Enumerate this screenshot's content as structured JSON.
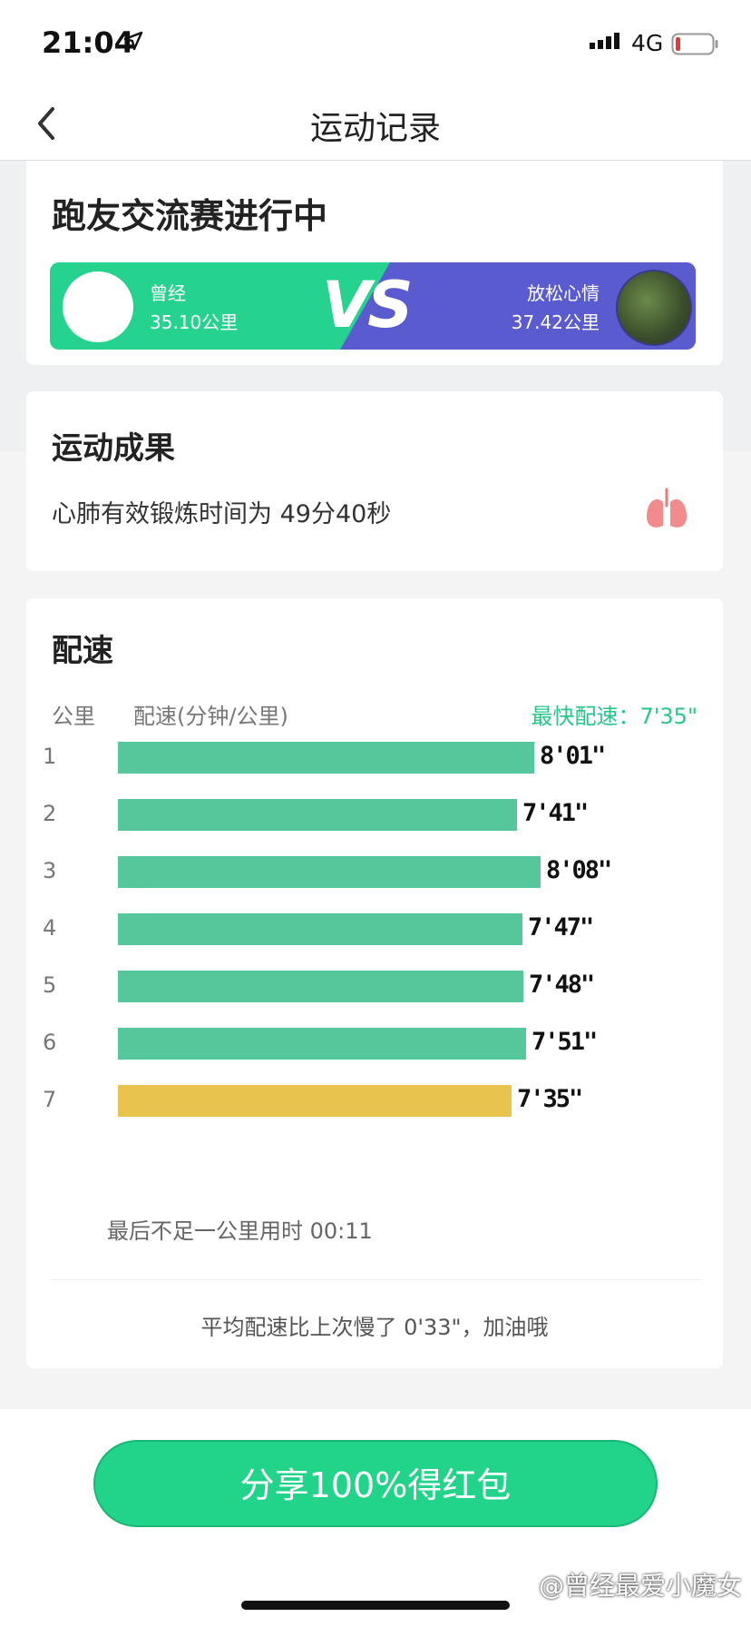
{
  "status_bar": {
    "time": "21:04",
    "network": "4G"
  },
  "nav": {
    "title": "运动记录"
  },
  "race": {
    "title": "跑友交流赛进行中",
    "vs_label": "VS",
    "left_player": {
      "name": "曾经",
      "distance": "35.10公里"
    },
    "right_player": {
      "name": "放松心情",
      "distance": "37.42公里"
    }
  },
  "result": {
    "title": "运动成果",
    "text": "心肺有效锻炼时间为 49分40秒"
  },
  "pace": {
    "title": "配速",
    "col_km": "公里",
    "col_pace": "配速(分钟/公里)",
    "fastest": "最快配速：7'35\"",
    "rows": [
      {
        "km": "1",
        "pace": "8'01\"",
        "seconds": 481,
        "color": "#55c79b"
      },
      {
        "km": "2",
        "pace": "7'41\"",
        "seconds": 461,
        "color": "#55c79b"
      },
      {
        "km": "3",
        "pace": "8'08\"",
        "seconds": 488,
        "color": "#55c79b"
      },
      {
        "km": "4",
        "pace": "7'47\"",
        "seconds": 467,
        "color": "#55c79b"
      },
      {
        "km": "5",
        "pace": "7'48\"",
        "seconds": 468,
        "color": "#55c79b"
      },
      {
        "km": "6",
        "pace": "7'51\"",
        "seconds": 471,
        "color": "#55c79b"
      },
      {
        "km": "7",
        "pace": "7'35\"",
        "seconds": 455,
        "color": "#e8c34d"
      }
    ],
    "last_note": "最后不足一公里用时 00:11",
    "avg_note": "平均配速比上次慢了 0'33\"，加油哦"
  },
  "share_button": "分享100%得红包",
  "watermark": "@曾经最爱小魔女",
  "colors": {
    "accent": "#22d489",
    "vs_purple": "#5b5bd0",
    "fastest_bar": "#e8c34d"
  }
}
